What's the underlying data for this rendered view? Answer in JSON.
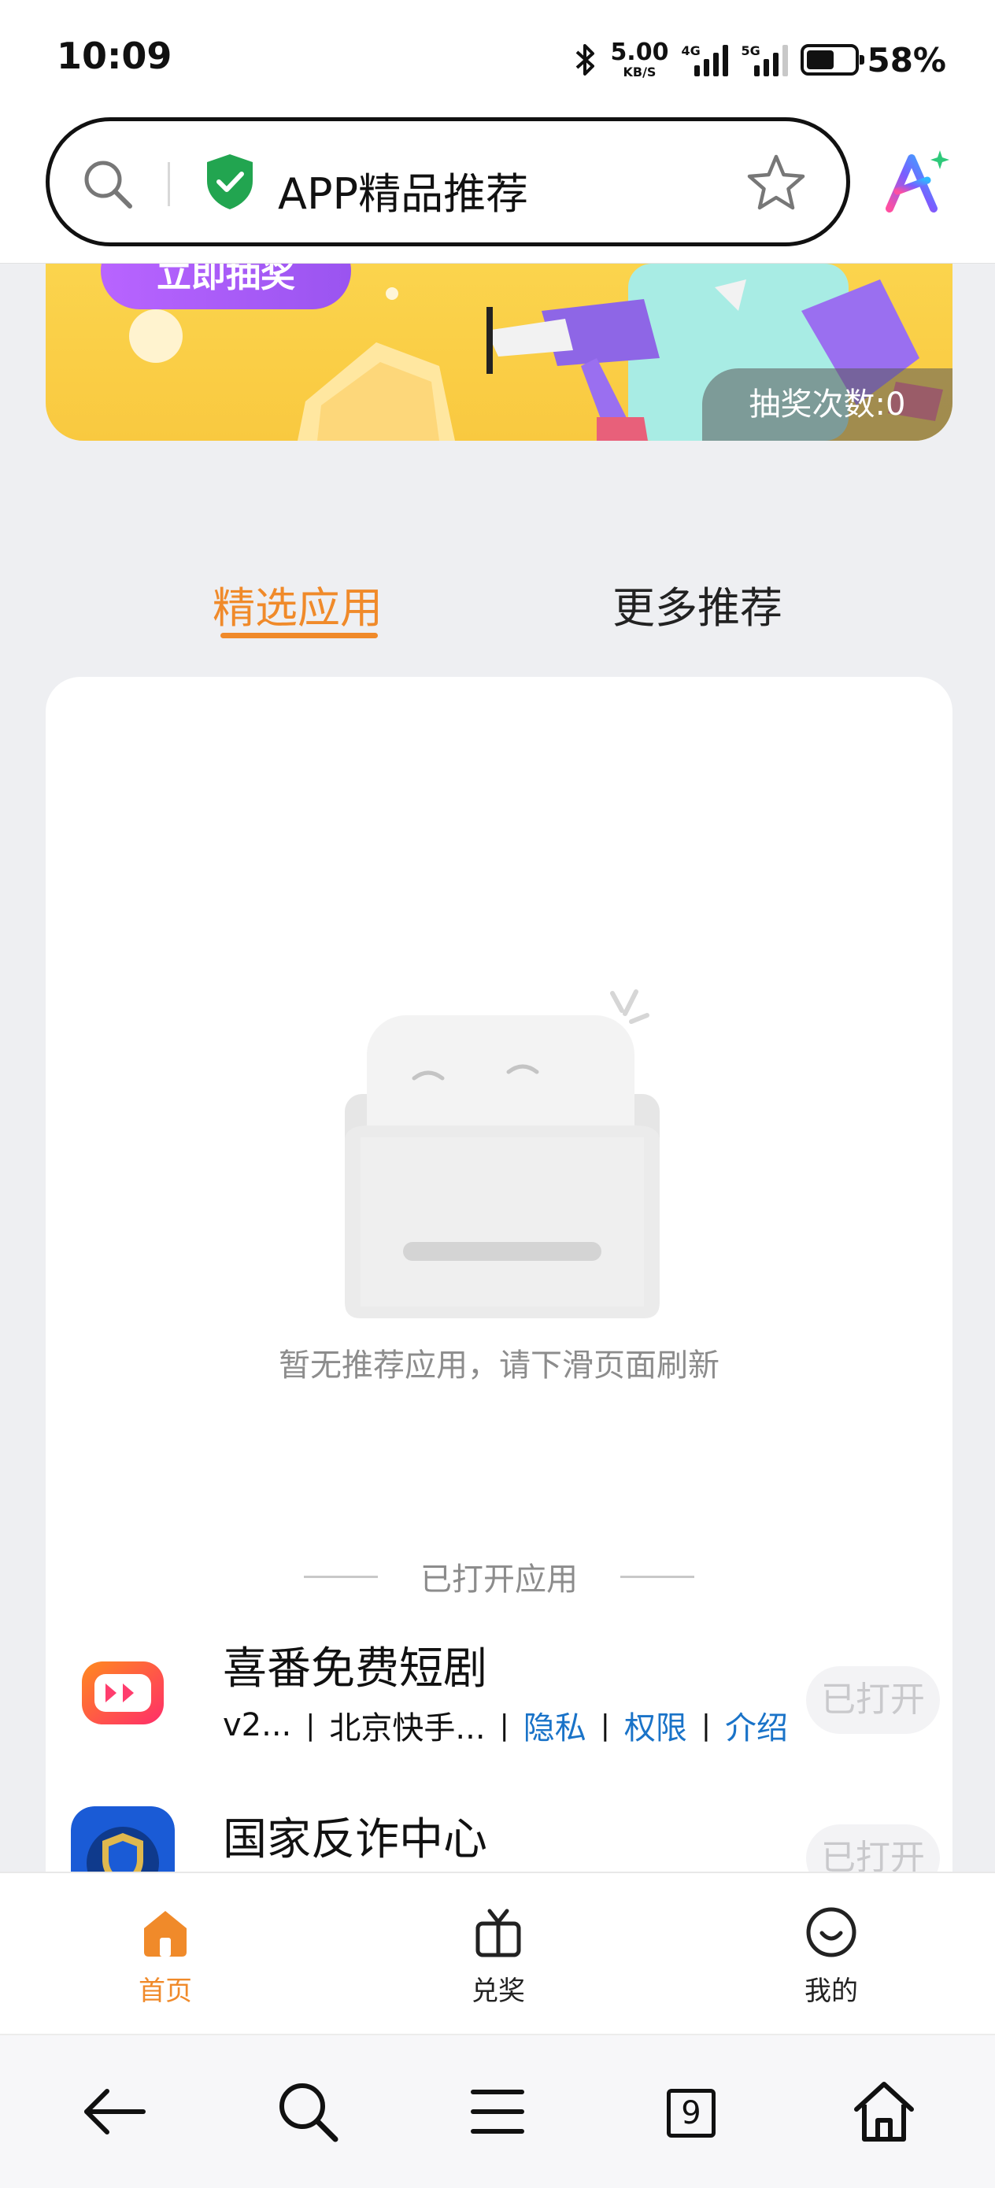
{
  "status_bar": {
    "time": "10:09",
    "net_speed_value": "5.00",
    "net_speed_unit": "KB/S",
    "sim1_tag": "4G",
    "sim2_tag": "5G",
    "battery_percent": "58%",
    "battery_level": 0.58
  },
  "address_bar": {
    "page_title": "APP精品推荐",
    "shield_color": "#22a550"
  },
  "banner": {
    "button_label": "立即抽奖",
    "lottery_count": "抽奖次数:0"
  },
  "tabs": [
    {
      "label": "精选应用",
      "active": true
    },
    {
      "label": "更多推荐",
      "active": false
    }
  ],
  "empty_state": {
    "message": "暂无推荐应用，请下滑页面刷新"
  },
  "opened_section": {
    "title": "已打开应用",
    "apps": [
      {
        "name": "喜番免费短剧",
        "version": "v2...",
        "developer": "北京快手...",
        "links": [
          "隐私",
          "权限",
          "介绍"
        ],
        "action": "已打开"
      },
      {
        "name": "国家反诈中心",
        "action": "已打开"
      }
    ]
  },
  "app_nav": {
    "items": [
      {
        "label": "首页",
        "active": true
      },
      {
        "label": "兑奖",
        "active": false
      },
      {
        "label": "我的",
        "active": false
      }
    ]
  },
  "browser_toolbar": {
    "tab_count": "9"
  },
  "colors": {
    "accent": "#f08a2a",
    "link": "#1a73c8",
    "banner": "#fbd44d"
  }
}
